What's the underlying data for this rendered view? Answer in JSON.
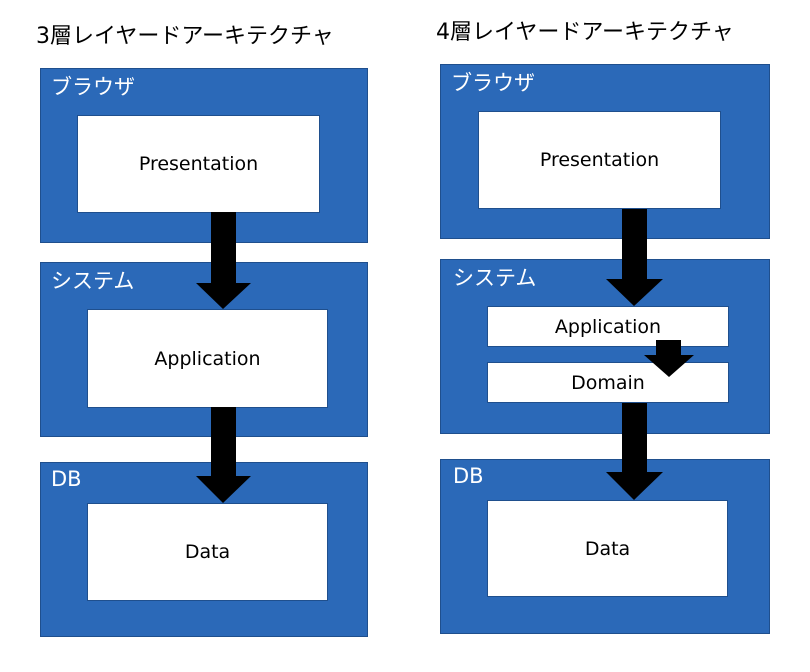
{
  "left": {
    "title": "3層レイヤードアーキテクチャ",
    "browser": {
      "label": "ブラウザ",
      "layer": "Presentation"
    },
    "system": {
      "label": "システム",
      "layer": "Application"
    },
    "db": {
      "label": "DB",
      "layer": "Data"
    }
  },
  "right": {
    "title": "4層レイヤードアーキテクチャ",
    "browser": {
      "label": "ブラウザ",
      "layer": "Presentation"
    },
    "system": {
      "label": "システム",
      "layers": [
        "Application",
        "Domain"
      ]
    },
    "db": {
      "label": "DB",
      "layer": "Data"
    }
  },
  "colors": {
    "tier_fill": "#2b69b8",
    "arrow": "#000000"
  }
}
